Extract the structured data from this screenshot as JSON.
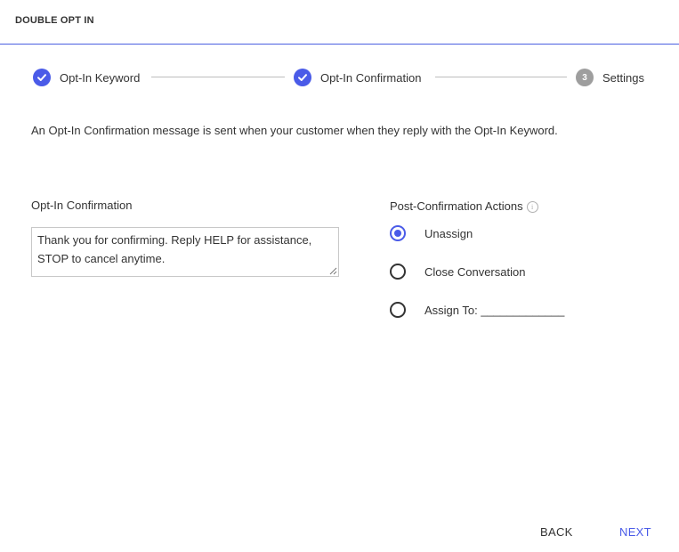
{
  "header": {
    "title": "DOUBLE OPT IN"
  },
  "colors": {
    "accent": "#4a5be8",
    "header_border": "#4a5fe0",
    "pending_step": "#9e9e9e",
    "text": "#333333"
  },
  "stepper": {
    "steps": [
      {
        "label": "Opt-In Keyword",
        "status": "complete",
        "icon": "check-icon"
      },
      {
        "label": "Opt-In Confirmation",
        "status": "complete",
        "icon": "check-icon"
      },
      {
        "label": "Settings",
        "status": "pending",
        "number": "3"
      }
    ]
  },
  "intro": {
    "text": "An Opt-In Confirmation message is sent when your customer when they reply with the Opt-In Keyword."
  },
  "confirmation": {
    "label": "Opt-In Confirmation",
    "value": "Thank you for confirming. Reply HELP for assistance, STOP to cancel anytime."
  },
  "post_actions": {
    "label": "Post-Confirmation Actions",
    "info_icon": "info-icon",
    "options": [
      {
        "label": "Unassign",
        "checked": true
      },
      {
        "label": "Close Conversation",
        "checked": false
      },
      {
        "label": "Assign To: _____________",
        "checked": false
      }
    ]
  },
  "footer": {
    "back_label": "BACK",
    "next_label": "NEXT"
  }
}
